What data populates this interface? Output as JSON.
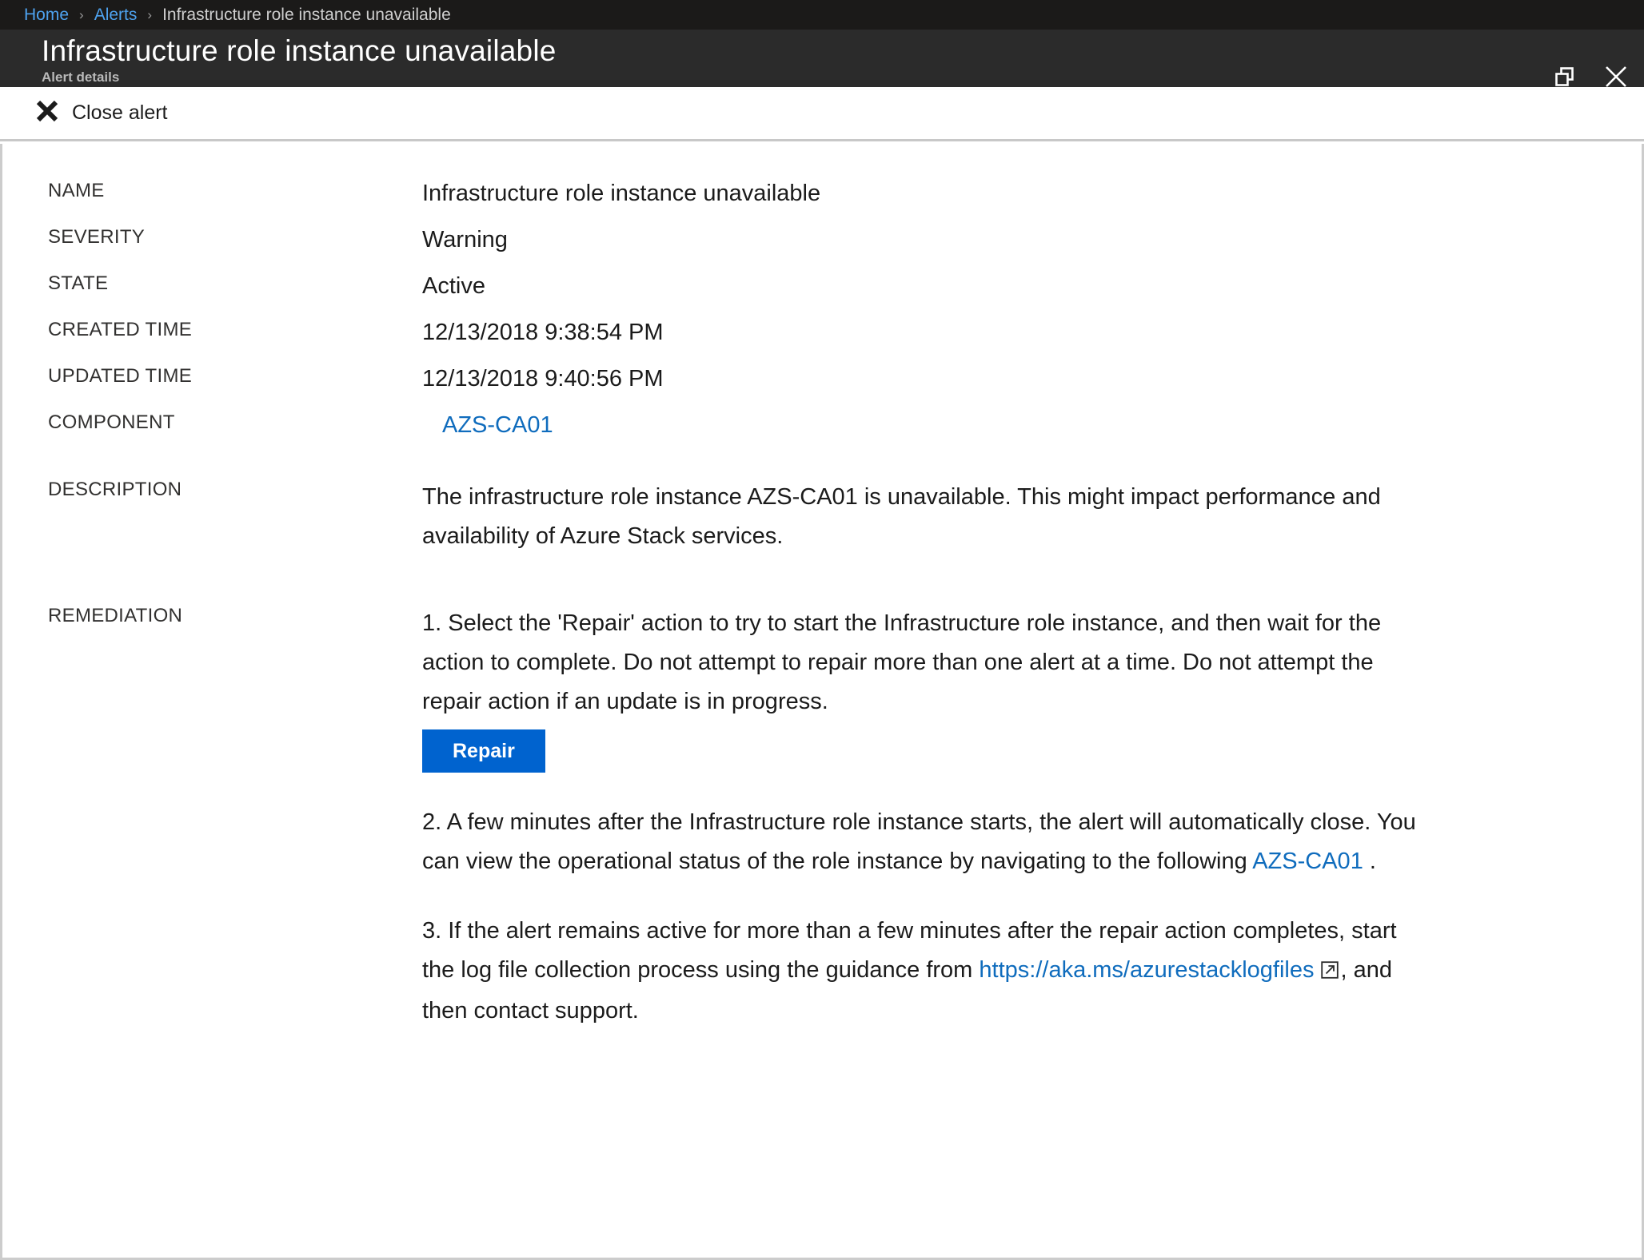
{
  "breadcrumb": {
    "items": [
      {
        "label": "Home",
        "type": "link"
      },
      {
        "label": "Alerts",
        "type": "link"
      },
      {
        "label": "Infrastructure role instance unavailable",
        "type": "current"
      }
    ],
    "separator": "›"
  },
  "header": {
    "title": "Infrastructure role instance unavailable",
    "subtitle": "Alert details",
    "restore_icon": "restore-window-icon",
    "close_icon": "close-window-icon"
  },
  "toolbar": {
    "close_alert_label": "Close alert",
    "close_alert_icon": "x-bold-icon"
  },
  "details": {
    "labels": {
      "name": "NAME",
      "severity": "SEVERITY",
      "state": "STATE",
      "created_time": "CREATED TIME",
      "updated_time": "UPDATED TIME",
      "component": "COMPONENT",
      "description": "DESCRIPTION",
      "remediation": "REMEDIATION"
    },
    "values": {
      "name": "Infrastructure role instance unavailable",
      "severity": "Warning",
      "state": "Active",
      "created_time": "12/13/2018 9:38:54 PM",
      "updated_time": "12/13/2018 9:40:56 PM",
      "component": "AZS-CA01",
      "description": "The infrastructure role instance AZS-CA01 is unavailable. This might impact performance and availability of Azure Stack services."
    }
  },
  "remediation": {
    "step1_text": "1. Select the 'Repair' action to try to start the Infrastructure role instance, and then wait for the action to complete. Do not attempt to repair more than one alert at a time. Do not attempt the repair action if an update is in progress.",
    "repair_button_label": "Repair",
    "step2_before_link": "2. A few minutes after the Infrastructure role instance starts, the alert will automatically close. You can view the operational status of the role instance by navigating to the following ",
    "step2_link": "AZS-CA01",
    "step2_after_link": " .",
    "step3_before_link": "3. If the alert remains active for more than a few minutes after the repair action completes, start the log file collection process using the guidance from ",
    "step3_link": "https://aka.ms/azurestacklogfiles",
    "step3_external_icon": "external-link-icon",
    "step3_after_link": ", and then contact support."
  },
  "colors": {
    "breadcrumb_bg": "#1b1a19",
    "title_bg": "#2b2b2b",
    "link_blue": "#0f6cbd",
    "breadcrumb_link_blue": "#4ea3f0",
    "repair_button_blue": "#0063cf",
    "panel_border": "#cccccc"
  }
}
